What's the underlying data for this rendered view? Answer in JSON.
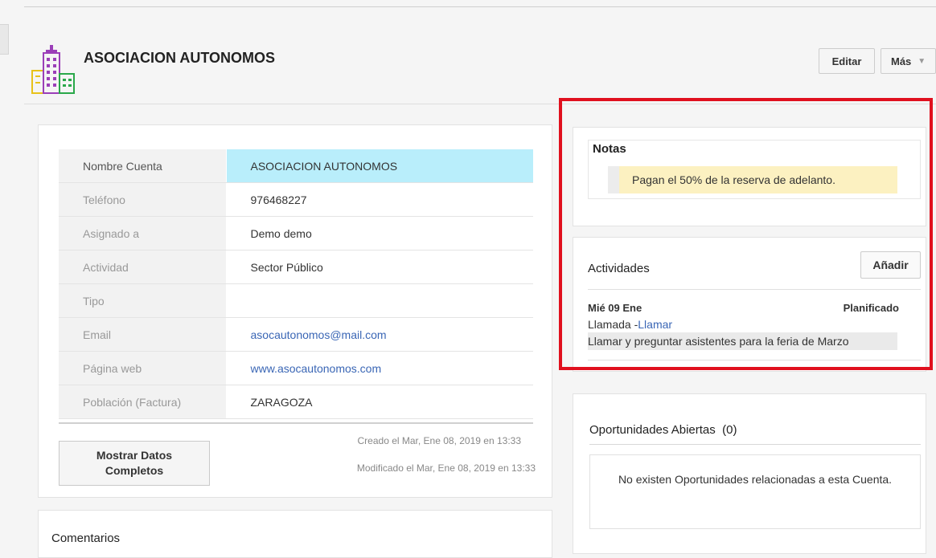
{
  "header": {
    "title": "ASOCIACION AUTONOMOS",
    "logo_icon": "buildings-icon",
    "buttons": {
      "edit": "Editar",
      "more": "Más"
    }
  },
  "details": {
    "rows": [
      {
        "label": "Nombre Cuenta",
        "value": "ASOCIACION AUTONOMOS"
      },
      {
        "label": "Teléfono",
        "value": "976468227"
      },
      {
        "label": "Asignado a",
        "value": "Demo demo"
      },
      {
        "label": "Actividad",
        "value": "Sector Público"
      },
      {
        "label": "Tipo",
        "value": ""
      },
      {
        "label": "Email",
        "value": "asocautonomos@mail.com"
      },
      {
        "label": "Página web",
        "value": "www.asocautonomos.com"
      },
      {
        "label": "Población (Factura)",
        "value": "ZARAGOZA"
      }
    ],
    "show_full_line1": "Mostrar Datos",
    "show_full_line2": "Completos",
    "created": "Creado el Mar, Ene 08, 2019 en 13:33",
    "modified": "Modificado el Mar, Ene 08, 2019 en 13:33"
  },
  "comments": {
    "title": "Comentarios"
  },
  "notes": {
    "title": "Notas",
    "text": "Pagan el 50% de la reserva de adelanto."
  },
  "activities": {
    "title": "Actividades",
    "add_label": "Añadir",
    "item": {
      "date": "Mié 09 Ene",
      "status": "Planificado",
      "type": "Llamada -",
      "link": "Llamar",
      "description": "Llamar y preguntar asistentes para la feria de Marzo"
    }
  },
  "opportunities": {
    "title": "Oportunidades Abiertas  (0)",
    "empty": "No existen Oportunidades relacionadas a esta Cuenta."
  },
  "colors": {
    "highlight_red": "#e0101e",
    "note_bg": "#fcf1c1",
    "row_highlight": "#b9eefb",
    "link": "#3a66b5"
  }
}
